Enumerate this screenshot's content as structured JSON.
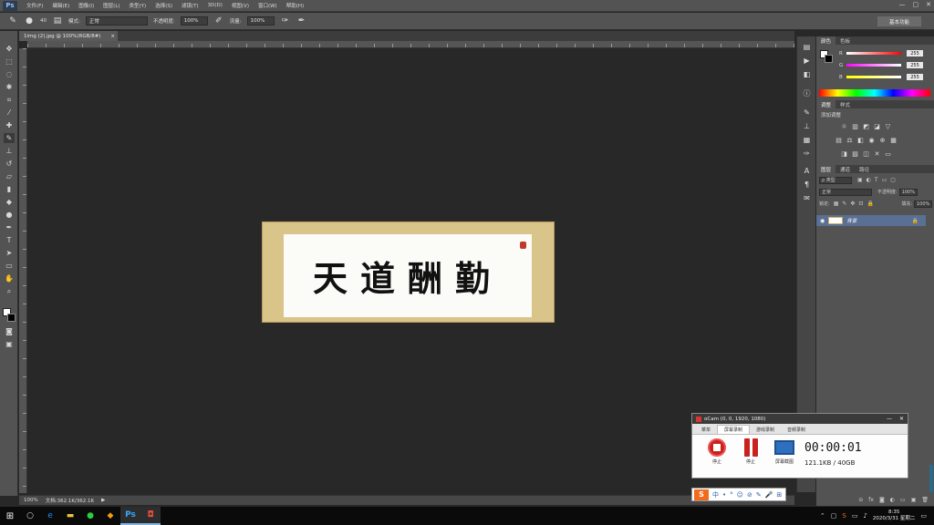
{
  "app": {
    "logo": "Ps",
    "menu": [
      "文件(F)",
      "编辑(E)",
      "图像(I)",
      "图层(L)",
      "类型(Y)",
      "选择(S)",
      "滤镜(T)",
      "3D(D)",
      "视图(V)",
      "窗口(W)",
      "帮助(H)"
    ],
    "window_controls": [
      "—",
      "▢",
      "✕"
    ]
  },
  "options": {
    "brush_size": "40",
    "mode_label": "模式:",
    "mode_value": "正常",
    "opacity_label": "不透明度:",
    "opacity_value": "100%",
    "flow_label": "流量:",
    "flow_value": "100%",
    "workspace": "基本功能"
  },
  "document": {
    "tab_title": "1img (2).jpg @ 100%(RGB/8#)",
    "tab_close": "×",
    "calligraphy": "天道酬勤"
  },
  "status": {
    "zoom": "100%",
    "doc_info": "文档:362.1K/362.1K",
    "arrow": "▶"
  },
  "panels": {
    "color_tabs": [
      "颜色",
      "色板"
    ],
    "sliders": [
      {
        "letter": "R",
        "value": "255",
        "color": "#ff0000"
      },
      {
        "letter": "G",
        "value": "255",
        "color": "#00ff00"
      },
      {
        "letter": "B",
        "value": "255",
        "color": "#0000ff"
      }
    ],
    "adjust_tabs": [
      "调整",
      "样式"
    ],
    "adjust_title": "添加调整",
    "layer_tabs": [
      "图层",
      "通道",
      "路径"
    ],
    "layer_kind": "ρ 类型",
    "blend_mode": "正常",
    "opacity_label": "不透明度:",
    "opacity_value": "100%",
    "lock_label": "锁定:",
    "fill_label": "填充:",
    "fill_value": "100%",
    "layer_name": "背景"
  },
  "ocam": {
    "title": "oCam (0, 0, 1920, 1080)",
    "tabs": [
      "菜单",
      "屏幕录制",
      "游戏录制",
      "音频录制"
    ],
    "record_label": "停止",
    "pause_label": "停止",
    "screen_label": "屏幕截图",
    "timer": "00:00:01",
    "size": "121.1KB / 40GB"
  },
  "ime": {
    "logo": "S",
    "items": [
      "中",
      "•",
      "°",
      "☺",
      "⊘",
      "✎",
      "🎤",
      "⊞"
    ]
  },
  "taskbar": {
    "time": "8:35",
    "date": "2020/3/31 星期二"
  }
}
